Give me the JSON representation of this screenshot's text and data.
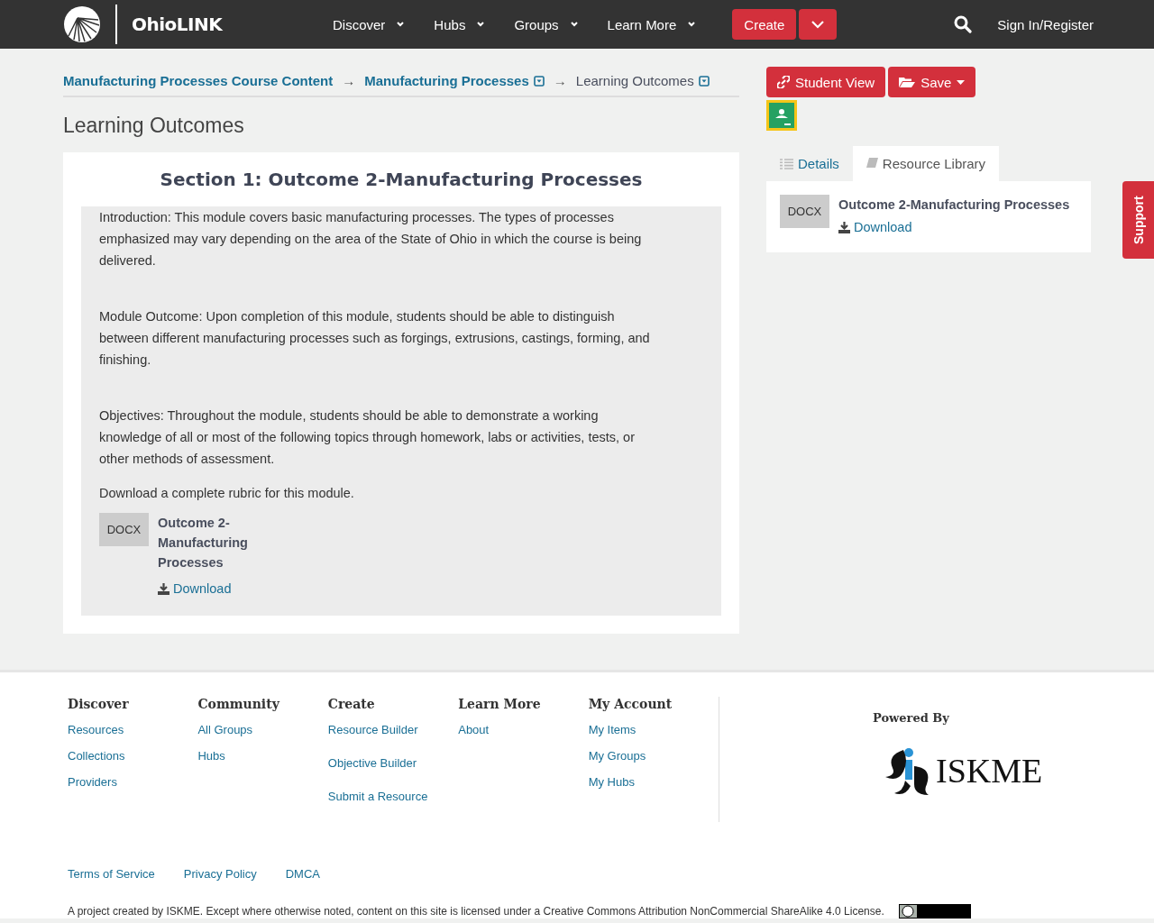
{
  "header": {
    "brand": "OhioLINK",
    "nav": [
      {
        "label": "Discover"
      },
      {
        "label": "Hubs"
      },
      {
        "label": "Groups"
      },
      {
        "label": "Learn More"
      }
    ],
    "create_button": "Create",
    "sign_in": "Sign In/Register"
  },
  "breadcrumbs": [
    {
      "label": "Manufacturing Processes Course Content",
      "kind": "link"
    },
    {
      "separator": "→",
      "label": "Manufacturing Processes",
      "kind": "dropdown-link"
    },
    {
      "separator": "→",
      "label": "Learning Outcomes",
      "kind": "dropdown-current"
    }
  ],
  "page_title": "Learning Outcomes",
  "section": {
    "title": "Section 1: Outcome 2-Manufacturing Processes",
    "paragraphs": [
      "Introduction: This module covers basic manufacturing processes. The types of processes emphasized may vary depending on the area of the State of Ohio in which the course is being delivered.",
      "Module Outcome: Upon completion of this module, students should be able to distinguish between different manufacturing processes such as forgings, extrusions, castings, forming, and finishing.",
      "Objectives: Throughout the module, students should be able to demonstrate a working knowledge of all or most of the following topics through homework, labs or activities, tests, or other methods of assessment."
    ],
    "rubric_note": "Download a complete rubric for this module.",
    "file": {
      "type": "DOCX",
      "name": "Outcome 2-Manufacturing Processes",
      "download": "Download"
    }
  },
  "actions": {
    "student_view": "Student View",
    "save": "Save"
  },
  "tabs": [
    {
      "label": "Details",
      "selected": false
    },
    {
      "label": "Resource Library",
      "selected": true
    }
  ],
  "library": [
    {
      "type": "DOCX",
      "name": "Outcome 2-Manufacturing Processes",
      "download": "Download"
    }
  ],
  "support": "Support",
  "footer": {
    "columns": [
      {
        "heading": "Discover",
        "links": [
          "Resources",
          "Collections",
          "Providers"
        ]
      },
      {
        "heading": "Community",
        "links": [
          "All Groups",
          "Hubs"
        ]
      },
      {
        "heading": "Create",
        "links": [
          "Resource Builder",
          "Objective Builder",
          "Submit a Resource"
        ]
      },
      {
        "heading": "Learn More",
        "links": [
          "About"
        ]
      },
      {
        "heading": "My Account",
        "links": [
          "My Items",
          "My Groups",
          "My Hubs"
        ]
      }
    ],
    "powered_by": "Powered By",
    "partner_logo": "ISKME",
    "legal_links": [
      "Terms of Service",
      "Privacy Policy",
      "DMCA"
    ],
    "license_note": "A project created by ISKME. Except where otherwise noted, content on this site is licensed under a Creative Commons Attribution NonCommercial ShareAlike 4.0 License."
  }
}
